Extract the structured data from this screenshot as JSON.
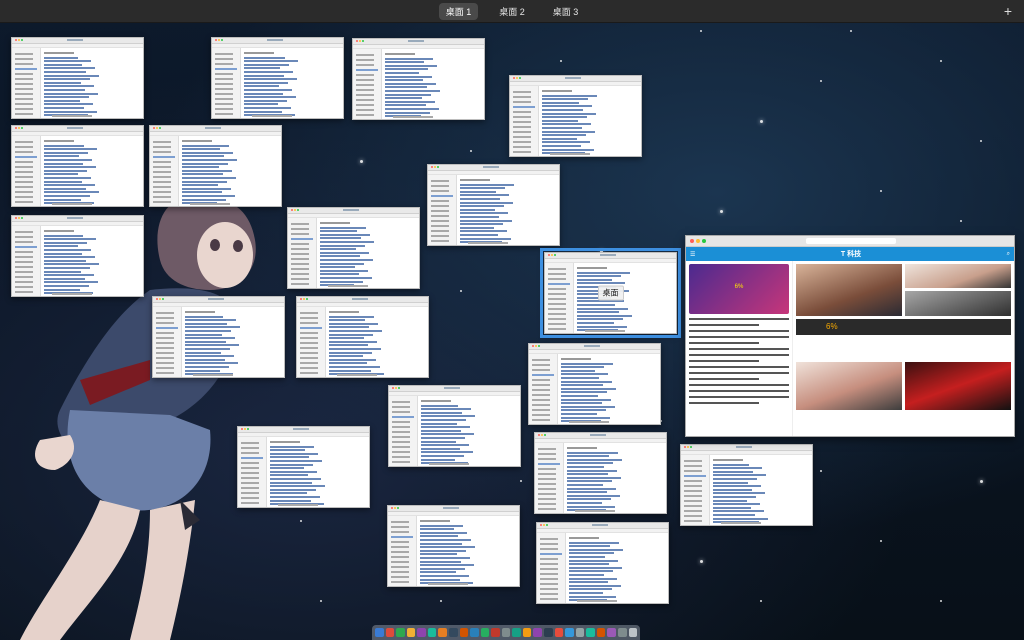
{
  "spaces": {
    "tabs": [
      "桌面 1",
      "桌面 2",
      "桌面 3"
    ],
    "active_index": 0,
    "add_symbol": "+"
  },
  "focused_window_label": "桌面",
  "browser": {
    "site_logo": "T 科技",
    "ad_text": "6%",
    "banner_text": "6%"
  },
  "dock": {
    "icon_colors": [
      "#3a7bd5",
      "#e04b3a",
      "#2fa84f",
      "#f2b134",
      "#8e44ad",
      "#1abc9c",
      "#e67e22",
      "#34495e",
      "#d35400",
      "#2980b9",
      "#27ae60",
      "#c0392b",
      "#7f8c8d",
      "#16a085",
      "#f39c12",
      "#8e44ad",
      "#2c3e50",
      "#e74c3c",
      "#3498db",
      "#95a5a6",
      "#1abc9c",
      "#d35400",
      "#9b59b6",
      "#7f8c8d",
      "#bdc3c7"
    ]
  },
  "colors": {
    "focus_outline": "#3d8fe0",
    "spaces_bar": "#2b2b2b"
  }
}
